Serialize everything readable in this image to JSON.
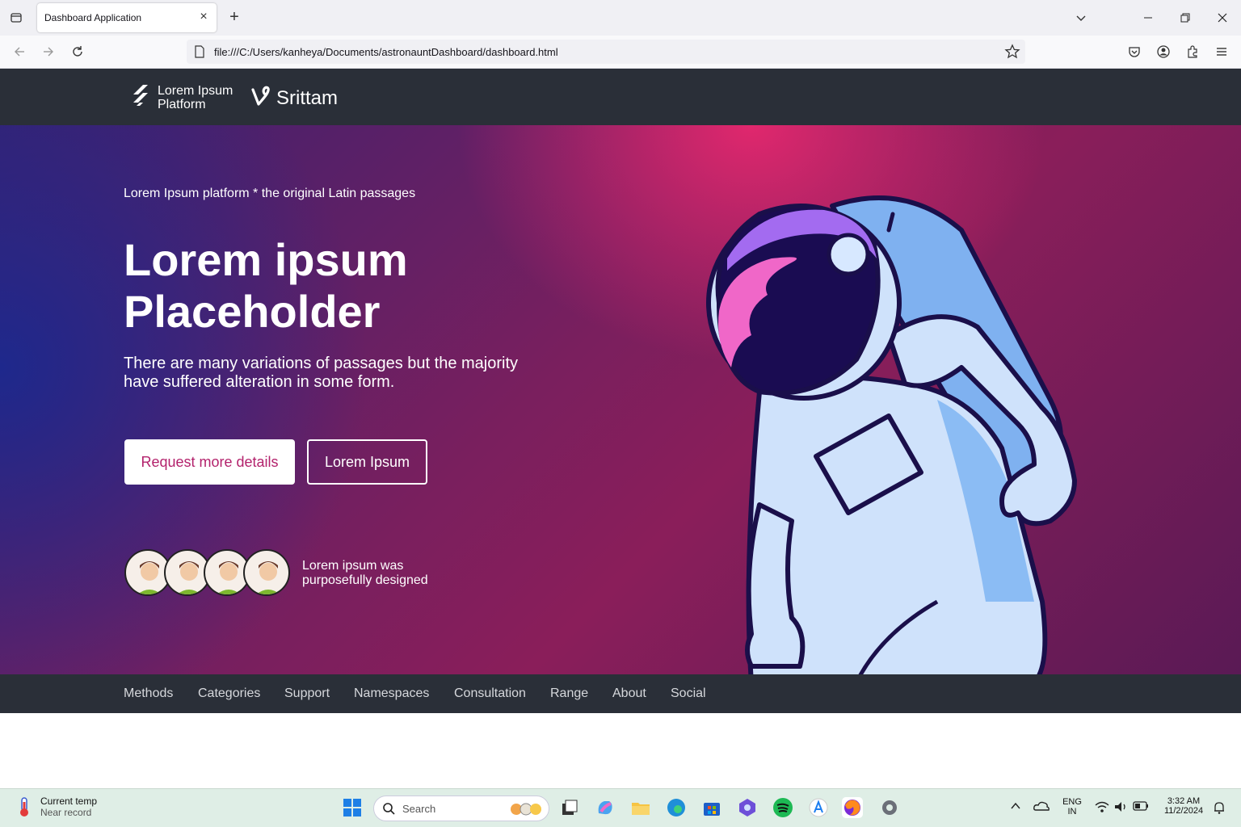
{
  "browser": {
    "tab_title": "Dashboard Application",
    "url": "file:///C:/Users/kanheya/Documents/astronauntDashboard/dashboard.html"
  },
  "header": {
    "logo1_text": "Lorem Ipsum Platform",
    "logo2_text": "Srittam"
  },
  "hero": {
    "kicker": "Lorem Ipsum platform * the original Latin passages",
    "title": "Lorem ipsum Placeholder",
    "subtitle": "There are many variations of passages but the majority have suffered alteration in some form.",
    "primary_button": "Request more details",
    "secondary_button": "Lorem Ipsum",
    "avatar_caption": "Lorem ipsum was purposefully designed"
  },
  "footer_nav": {
    "items": [
      "Methods",
      "Categories",
      "Support",
      "Namespaces",
      "Consultation",
      "Range",
      "About",
      "Social"
    ]
  },
  "taskbar": {
    "weather_title": "Current temp",
    "weather_sub": "Near record",
    "search_placeholder": "Search",
    "lang_top": "ENG",
    "lang_bottom": "IN",
    "time": "3:32 AM",
    "date": "11/2/2024"
  },
  "colors": {
    "header_bg": "#2a2f38",
    "accent": "#b3226c",
    "hero_pink": "#e6286e",
    "hero_blue": "#1e288c"
  }
}
